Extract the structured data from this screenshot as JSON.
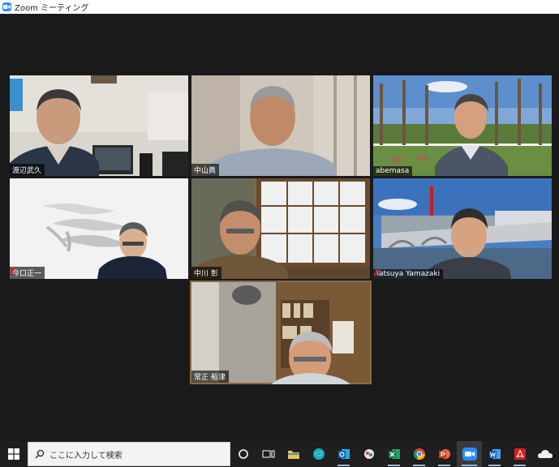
{
  "window": {
    "app_name": "Zoom",
    "title": "ミーティング"
  },
  "participants": [
    {
      "name": "渡辺武久",
      "muted": false,
      "active_speaker": false
    },
    {
      "name": "中山眞",
      "muted": false,
      "active_speaker": false
    },
    {
      "name": "abemasa",
      "muted": false,
      "active_speaker": false
    },
    {
      "name": "今口正一",
      "muted": true,
      "active_speaker": false
    },
    {
      "name": "中川 彰",
      "muted": false,
      "active_speaker": false
    },
    {
      "name": "Tatsuya Yamazaki",
      "muted": true,
      "active_speaker": false
    },
    {
      "name": "常正 船津",
      "muted": false,
      "active_speaker": true
    }
  ],
  "taskbar": {
    "search_placeholder": "ここに入力して検索",
    "apps": [
      "cortana-icon",
      "task-view-icon",
      "file-explorer-icon",
      "edge-icon",
      "outlook-icon",
      "photos-icon",
      "excel-icon",
      "chrome-icon",
      "powerpoint-icon",
      "zoom-icon",
      "word-icon",
      "acrobat-icon",
      "onedrive-icon"
    ]
  },
  "colors": {
    "active_speaker_border": "#b7e15a",
    "zoom_blue": "#2d8cff",
    "muted_icon": "#e02828"
  }
}
